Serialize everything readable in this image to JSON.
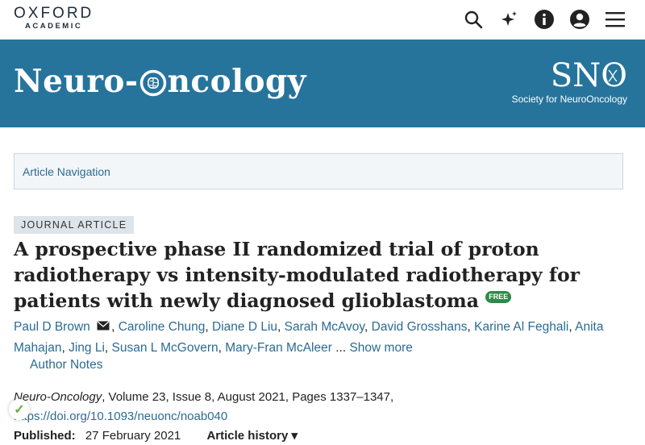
{
  "header": {
    "logo_main": "OXFORD",
    "logo_sub": "ACADEMIC",
    "icons": [
      "search-icon",
      "ai-sparkle-icon",
      "info-icon",
      "account-icon",
      "menu-icon"
    ]
  },
  "banner": {
    "title_part1": "Neuro-",
    "title_part2": "ncology",
    "society_abbr_s": "SN",
    "society_abbr_o": "O",
    "society_name": "Society for NeuroOncology",
    "background": "#26749c"
  },
  "article_nav": {
    "label": "Article Navigation"
  },
  "article": {
    "type_badge": "JOURNAL ARTICLE",
    "title": "A prospective phase II randomized trial of proton radiotherapy vs intensity-modulated radiotherapy for patients with newly diagnosed glioblastoma",
    "free_label": "FREE",
    "authors": [
      "Paul D Brown",
      "Caroline Chung",
      "Diane D Liu",
      "Sarah McAvoy",
      "David Grosshans",
      "Karine Al Feghali",
      "Anita Mahajan",
      "Jing Li",
      "Susan L McGovern",
      "Mary-Fran McAleer"
    ],
    "show_more": "Show more",
    "ellipsis": "...",
    "author_notes": "Author Notes",
    "journal_name": "Neuro-Oncology",
    "citation_rest": ", Volume 23, Issue 8, August 2021, Pages 1337–1347,",
    "doi": "https://doi.org/10.1093/neuonc/noab040",
    "published_label": "Published:",
    "published_date": "27 February 2021",
    "history_label": "Article history ▾"
  },
  "colors": {
    "link": "#2b6b93",
    "banner": "#26749c",
    "free": "#2e8b47"
  }
}
